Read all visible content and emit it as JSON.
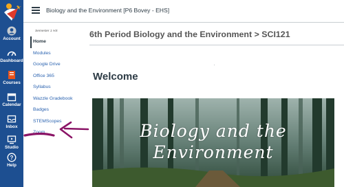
{
  "header": {
    "breadcrumb": "Biology and the Environment [P6 Bovey - EHS]"
  },
  "global_nav": {
    "items": [
      {
        "label": "Account",
        "icon": "account-icon"
      },
      {
        "label": "Dashboard",
        "icon": "dashboard-icon"
      },
      {
        "label": "Courses",
        "icon": "courses-icon"
      },
      {
        "label": "Calendar",
        "icon": "calendar-icon"
      },
      {
        "label": "Inbox",
        "icon": "inbox-icon"
      },
      {
        "label": "Studio",
        "icon": "studio-icon"
      },
      {
        "label": "Help",
        "icon": "help-icon"
      }
    ]
  },
  "course_nav": {
    "term": "Semester 1 HS",
    "items": [
      {
        "label": "Home"
      },
      {
        "label": "Modules"
      },
      {
        "label": "Google Drive"
      },
      {
        "label": "Office 365"
      },
      {
        "label": "Syllabus"
      },
      {
        "label": "Wazzle Gradebook"
      },
      {
        "label": "Badges"
      },
      {
        "label": "STEMScopes"
      },
      {
        "label": "Zoom"
      }
    ]
  },
  "main": {
    "page_title": "6th Period Biology and the Environment > SCI121",
    "dot": ".",
    "welcome": "Welcome",
    "banner_line1": "Biology and the",
    "banner_line2": "Environment"
  },
  "colors": {
    "nav_bg": "#1d4f91",
    "link": "#2b63b0",
    "annotation": "#8a1466",
    "courses_icon": "#e8541e"
  }
}
